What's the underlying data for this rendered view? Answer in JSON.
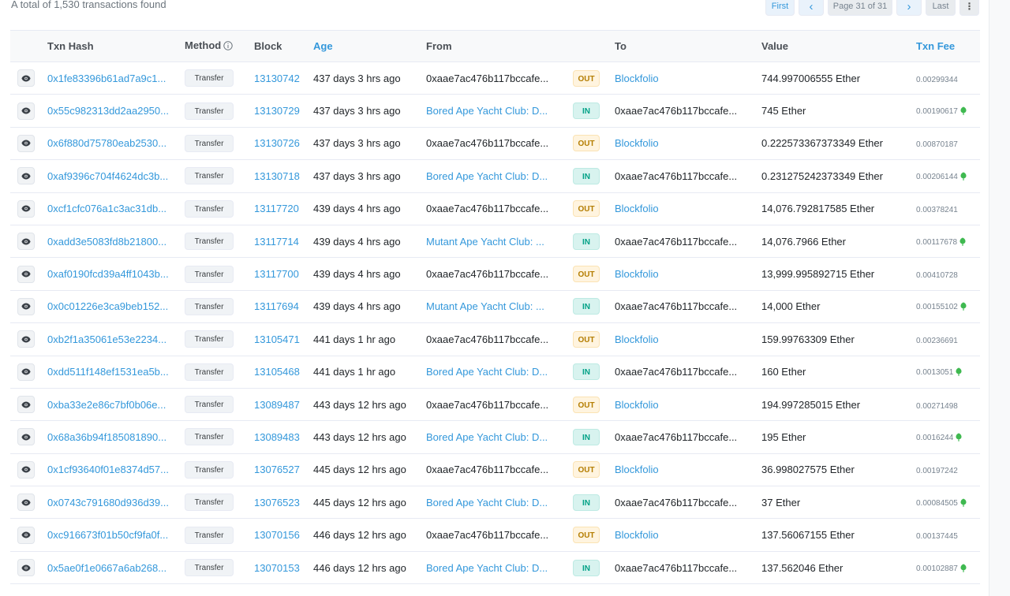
{
  "summary": {
    "total_text": "A total of 1,530 transactions found"
  },
  "pagination": {
    "first": "First",
    "prev": "‹",
    "current": "Page 31 of 31",
    "next": "›",
    "last": "Last",
    "more": "⋮"
  },
  "columns": [
    "Txn Hash",
    "Method",
    "Block",
    "Age",
    "From",
    "",
    "To",
    "Value",
    "Txn Fee"
  ],
  "rows": [
    {
      "hash": "0x1fe83396b61ad7a9c1...",
      "method": "Transfer",
      "block": "13130742",
      "age": "437 days 3 hrs ago",
      "from": "0xaae7ac476b117bccafe...",
      "from_link": false,
      "dir": "OUT",
      "to": "Blockfolio",
      "to_link": true,
      "value": "744.997006555 Ether",
      "fee": "0.00299344",
      "gas": false
    },
    {
      "hash": "0x55c982313dd2aa2950...",
      "method": "Transfer",
      "block": "13130729",
      "age": "437 days 3 hrs ago",
      "from": "Bored Ape Yacht Club: D...",
      "from_link": true,
      "dir": "IN",
      "to": "0xaae7ac476b117bccafe...",
      "to_link": false,
      "value": "745 Ether",
      "fee": "0.00190617",
      "gas": true
    },
    {
      "hash": "0x6f880d75780eab2530...",
      "method": "Transfer",
      "block": "13130726",
      "age": "437 days 3 hrs ago",
      "from": "0xaae7ac476b117bccafe...",
      "from_link": false,
      "dir": "OUT",
      "to": "Blockfolio",
      "to_link": true,
      "value": "0.222573367373349 Ether",
      "fee": "0.00870187",
      "gas": false
    },
    {
      "hash": "0xaf9396c704f4624dc3b...",
      "method": "Transfer",
      "block": "13130718",
      "age": "437 days 3 hrs ago",
      "from": "Bored Ape Yacht Club: D...",
      "from_link": true,
      "dir": "IN",
      "to": "0xaae7ac476b117bccafe...",
      "to_link": false,
      "value": "0.231275242373349 Ether",
      "fee": "0.00206144",
      "gas": true
    },
    {
      "hash": "0xcf1cfc076a1c3ac31db...",
      "method": "Transfer",
      "block": "13117720",
      "age": "439 days 4 hrs ago",
      "from": "0xaae7ac476b117bccafe...",
      "from_link": false,
      "dir": "OUT",
      "to": "Blockfolio",
      "to_link": true,
      "value": "14,076.792817585 Ether",
      "fee": "0.00378241",
      "gas": false
    },
    {
      "hash": "0xadd3e5083fd8b21800...",
      "method": "Transfer",
      "block": "13117714",
      "age": "439 days 4 hrs ago",
      "from": "Mutant Ape Yacht Club: ...",
      "from_link": true,
      "dir": "IN",
      "to": "0xaae7ac476b117bccafe...",
      "to_link": false,
      "value": "14,076.7966 Ether",
      "fee": "0.00117678",
      "gas": true
    },
    {
      "hash": "0xaf0190fcd39a4ff1043b...",
      "method": "Transfer",
      "block": "13117700",
      "age": "439 days 4 hrs ago",
      "from": "0xaae7ac476b117bccafe...",
      "from_link": false,
      "dir": "OUT",
      "to": "Blockfolio",
      "to_link": true,
      "value": "13,999.995892715 Ether",
      "fee": "0.00410728",
      "gas": false
    },
    {
      "hash": "0x0c01226e3ca9beb152...",
      "method": "Transfer",
      "block": "13117694",
      "age": "439 days 4 hrs ago",
      "from": "Mutant Ape Yacht Club: ...",
      "from_link": true,
      "dir": "IN",
      "to": "0xaae7ac476b117bccafe...",
      "to_link": false,
      "value": "14,000 Ether",
      "fee": "0.00155102",
      "gas": true
    },
    {
      "hash": "0xb2f1a35061e53e2234...",
      "method": "Transfer",
      "block": "13105471",
      "age": "441 days 1 hr ago",
      "from": "0xaae7ac476b117bccafe...",
      "from_link": false,
      "dir": "OUT",
      "to": "Blockfolio",
      "to_link": true,
      "value": "159.99763309 Ether",
      "fee": "0.00236691",
      "gas": false
    },
    {
      "hash": "0xdd511f148ef1531ea5b...",
      "method": "Transfer",
      "block": "13105468",
      "age": "441 days 1 hr ago",
      "from": "Bored Ape Yacht Club: D...",
      "from_link": true,
      "dir": "IN",
      "to": "0xaae7ac476b117bccafe...",
      "to_link": false,
      "value": "160 Ether",
      "fee": "0.0013051",
      "gas": true
    },
    {
      "hash": "0xba33e2e86c7bf0b06e...",
      "method": "Transfer",
      "block": "13089487",
      "age": "443 days 12 hrs ago",
      "from": "0xaae7ac476b117bccafe...",
      "from_link": false,
      "dir": "OUT",
      "to": "Blockfolio",
      "to_link": true,
      "value": "194.997285015 Ether",
      "fee": "0.00271498",
      "gas": false
    },
    {
      "hash": "0x68a36b94f185081890...",
      "method": "Transfer",
      "block": "13089483",
      "age": "443 days 12 hrs ago",
      "from": "Bored Ape Yacht Club: D...",
      "from_link": true,
      "dir": "IN",
      "to": "0xaae7ac476b117bccafe...",
      "to_link": false,
      "value": "195 Ether",
      "fee": "0.0016244",
      "gas": true
    },
    {
      "hash": "0x1cf93640f01e8374d57...",
      "method": "Transfer",
      "block": "13076527",
      "age": "445 days 12 hrs ago",
      "from": "0xaae7ac476b117bccafe...",
      "from_link": false,
      "dir": "OUT",
      "to": "Blockfolio",
      "to_link": true,
      "value": "36.998027575 Ether",
      "fee": "0.00197242",
      "gas": false
    },
    {
      "hash": "0x0743c791680d936d39...",
      "method": "Transfer",
      "block": "13076523",
      "age": "445 days 12 hrs ago",
      "from": "Bored Ape Yacht Club: D...",
      "from_link": true,
      "dir": "IN",
      "to": "0xaae7ac476b117bccafe...",
      "to_link": false,
      "value": "37 Ether",
      "fee": "0.00084505",
      "gas": true
    },
    {
      "hash": "0xc916673f01b50cf9fa0f...",
      "method": "Transfer",
      "block": "13070156",
      "age": "446 days 12 hrs ago",
      "from": "0xaae7ac476b117bccafe...",
      "from_link": false,
      "dir": "OUT",
      "to": "Blockfolio",
      "to_link": true,
      "value": "137.56067155 Ether",
      "fee": "0.00137445",
      "gas": false
    },
    {
      "hash": "0x5ae0f1e0667a6ab268...",
      "method": "Transfer",
      "block": "13070153",
      "age": "446 days 12 hrs ago",
      "from": "Bored Ape Yacht Club: D...",
      "from_link": true,
      "dir": "IN",
      "to": "0xaae7ac476b117bccafe...",
      "to_link": false,
      "value": "137.562046 Ether",
      "fee": "0.00102887",
      "gas": true
    }
  ]
}
